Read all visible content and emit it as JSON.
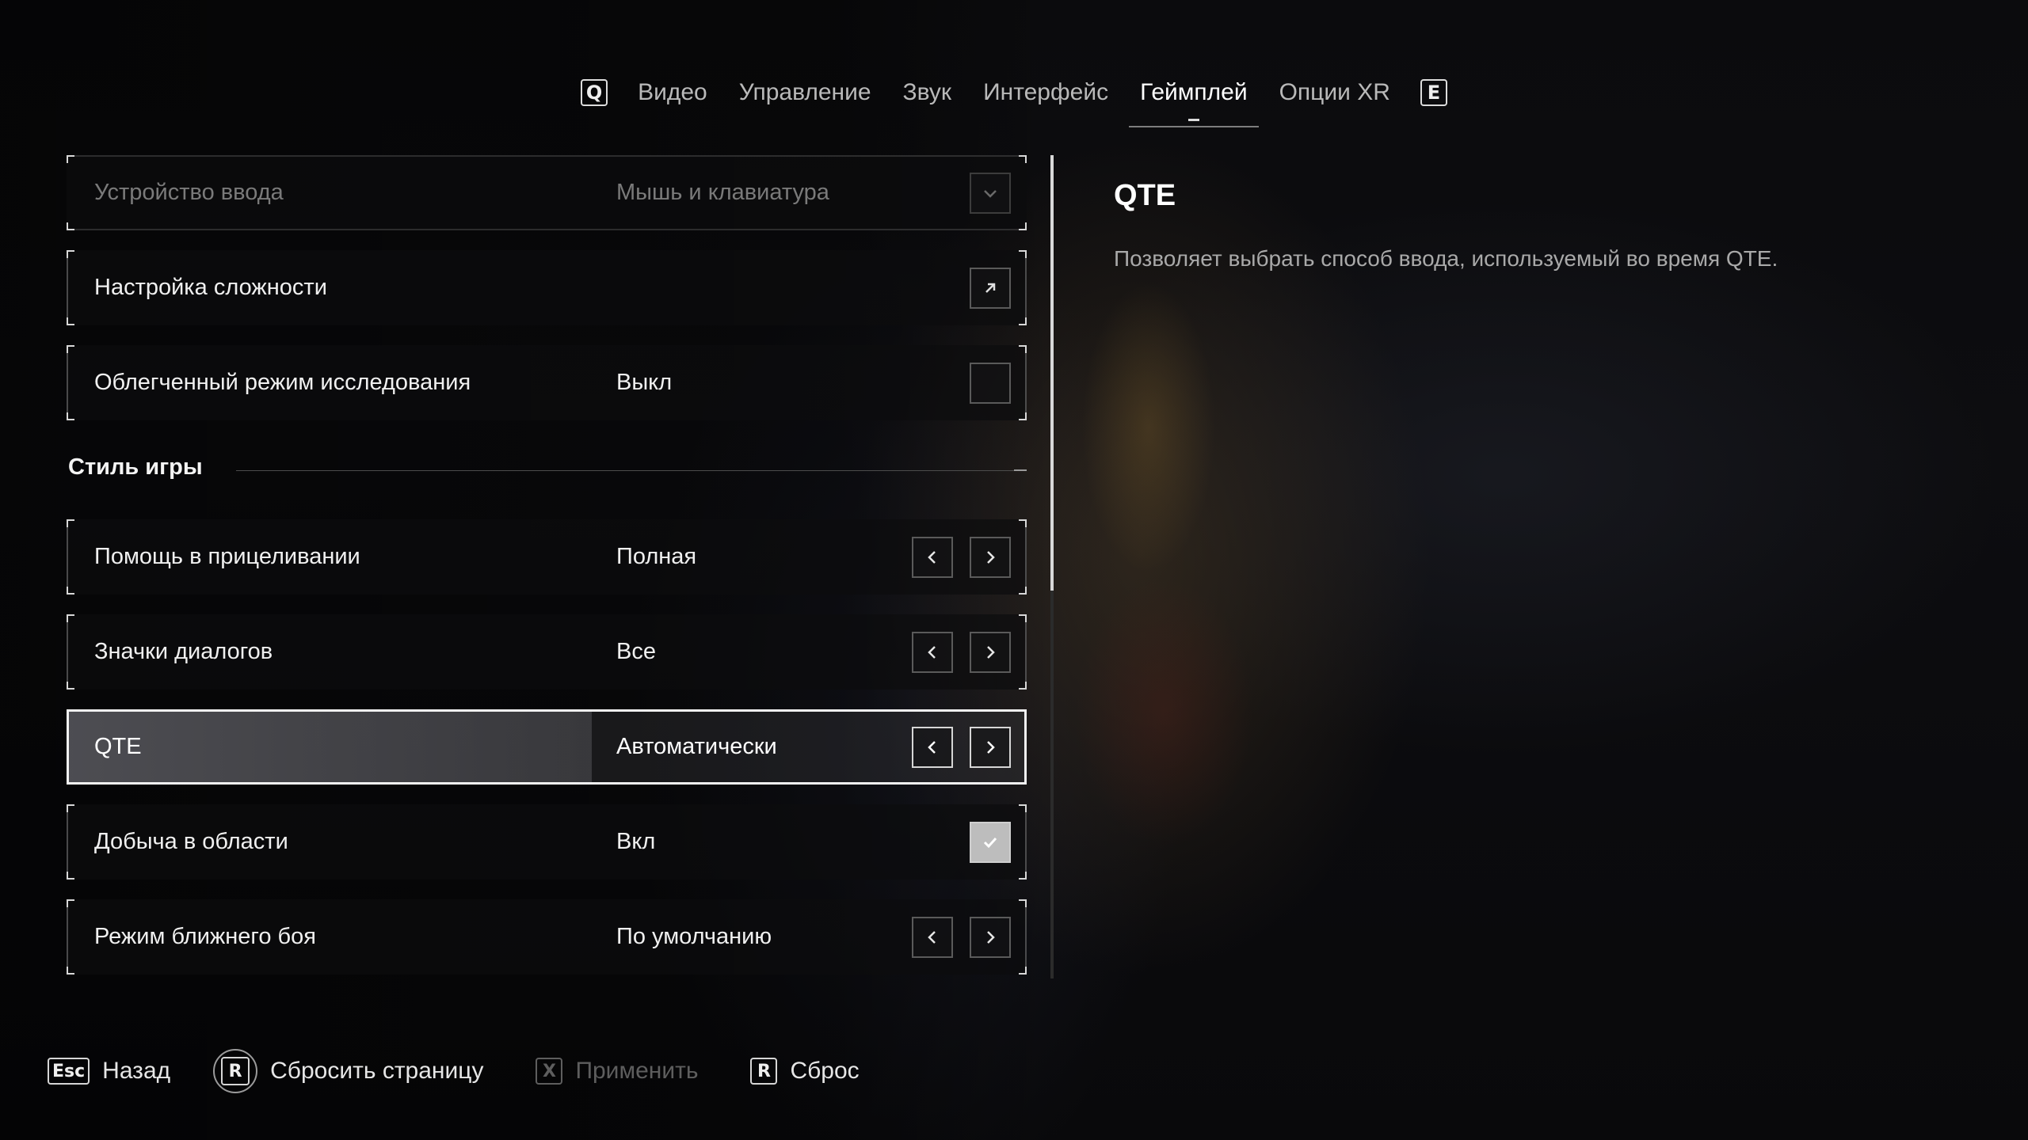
{
  "tabs": {
    "prev_key": "Q",
    "next_key": "E",
    "items": [
      {
        "label": "Видео"
      },
      {
        "label": "Управление"
      },
      {
        "label": "Звук"
      },
      {
        "label": "Интерфейс"
      },
      {
        "label": "Геймплей",
        "active": true
      },
      {
        "label": "Опции XR"
      }
    ]
  },
  "settings": {
    "rows_top": [
      {
        "label": "Устройство ввода",
        "value": "Мышь и клавиатура",
        "control": "dropdown",
        "disabled": true
      },
      {
        "label": "Настройка сложности",
        "value": "",
        "control": "link"
      },
      {
        "label": "Облегченный режим исследования",
        "value": "Выкл",
        "control": "checkbox",
        "checked": false
      }
    ],
    "section_title": "Стиль игры",
    "rows_section": [
      {
        "label": "Помощь в прицеливании",
        "value": "Полная",
        "control": "arrows"
      },
      {
        "label": "Значки диалогов",
        "value": "Все",
        "control": "arrows"
      },
      {
        "label": "QTE",
        "value": "Автоматически",
        "control": "arrows",
        "selected": true
      },
      {
        "label": "Добыча в области",
        "value": "Вкл",
        "control": "checkbox",
        "checked": true
      },
      {
        "label": "Режим ближнего боя",
        "value": "По умолчанию",
        "control": "arrows"
      }
    ]
  },
  "description": {
    "title": "QTE",
    "text": "Позволяет выбрать способ ввода, используемый во время QTE."
  },
  "footer": {
    "back": {
      "key": "Esc",
      "label": "Назад"
    },
    "reset_page": {
      "key": "R",
      "label": "Сбросить страницу"
    },
    "apply": {
      "key": "X",
      "label": "Применить",
      "disabled": true
    },
    "reset": {
      "key": "R",
      "label": "Сброс"
    }
  },
  "colors": {
    "background": "#0b0b0d",
    "text_primary": "#f0f0f0",
    "text_dim": "#7a7a7a",
    "selection_border": "#f2f2f2"
  }
}
